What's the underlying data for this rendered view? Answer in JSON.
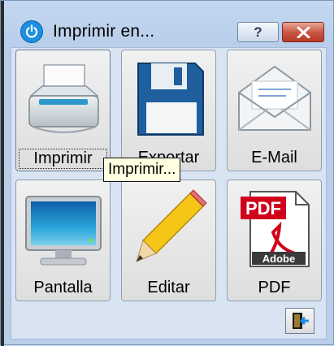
{
  "window": {
    "title": "Imprimir en...",
    "help_label": "?",
    "icons": {
      "app": "power-icon",
      "close": "close-x-icon",
      "help": "help-question-icon"
    }
  },
  "tiles": [
    {
      "label": "Imprimir",
      "icon": "printer-icon",
      "selected": true
    },
    {
      "label": "Exportar",
      "icon": "floppy-disk-icon",
      "selected": false
    },
    {
      "label": "E-Mail",
      "icon": "envelope-icon",
      "selected": false
    },
    {
      "label": "Pantalla",
      "icon": "monitor-icon",
      "selected": false
    },
    {
      "label": "Editar",
      "icon": "pencil-icon",
      "selected": false
    },
    {
      "label": "PDF",
      "icon": "pdf-document-icon",
      "selected": false
    }
  ],
  "pdf_art": {
    "badge": "PDF",
    "brand": "Adobe"
  },
  "tooltip": "Imprimir...",
  "exit_button": {
    "icon": "exit-door-icon"
  },
  "colors": {
    "accent": "#1b8fe0",
    "close": "#c8523e",
    "tooltip_bg": "#ffffe1",
    "pdf_red": "#d0021b"
  }
}
